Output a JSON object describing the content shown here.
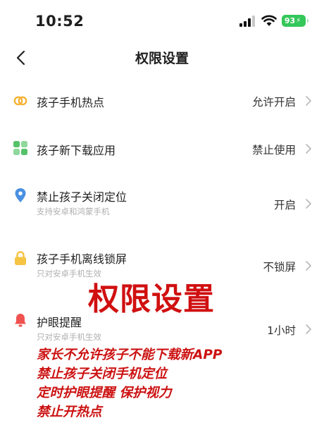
{
  "status_bar": {
    "time": "10:52",
    "battery": "93",
    "battery_color": "#34c759",
    "icons": [
      "cellular-signal-icon",
      "wifi-icon",
      "battery-charging-icon"
    ]
  },
  "header": {
    "title": "权限设置",
    "back_icon": "chevron-left-icon"
  },
  "settings": [
    {
      "title": "孩子手机热点",
      "subtitle": "",
      "value": "允许开启",
      "icon": "hotspot-link-icon",
      "icon_color": "#f5b233"
    },
    {
      "title": "孩子新下载应用",
      "subtitle": "",
      "value": "禁止使用",
      "icon": "apps-grid-icon",
      "icon_color": "#55c26a"
    },
    {
      "title": "禁止孩子关闭定位",
      "subtitle": "支持安卓和鸿蒙手机",
      "value": "开启",
      "icon": "location-pin-icon",
      "icon_color": "#4a90e2"
    },
    {
      "title": "孩子手机离线锁屏",
      "subtitle": "只对安卓手机生效",
      "value": "不锁屏",
      "icon": "lock-icon",
      "icon_color": "#f6c343"
    },
    {
      "title": "护眼提醒",
      "subtitle": "只对安卓手机生效",
      "value": "1小时",
      "icon": "bell-icon",
      "icon_color": "#ef5350"
    }
  ],
  "overlay": {
    "title": "权限设置",
    "lines": [
      "家长不允许孩子不能下载新APP",
      "禁止孩子关闭手机定位",
      "定时护眼提醒 保护视力",
      "禁止开热点"
    ],
    "color": "#cc1111"
  }
}
